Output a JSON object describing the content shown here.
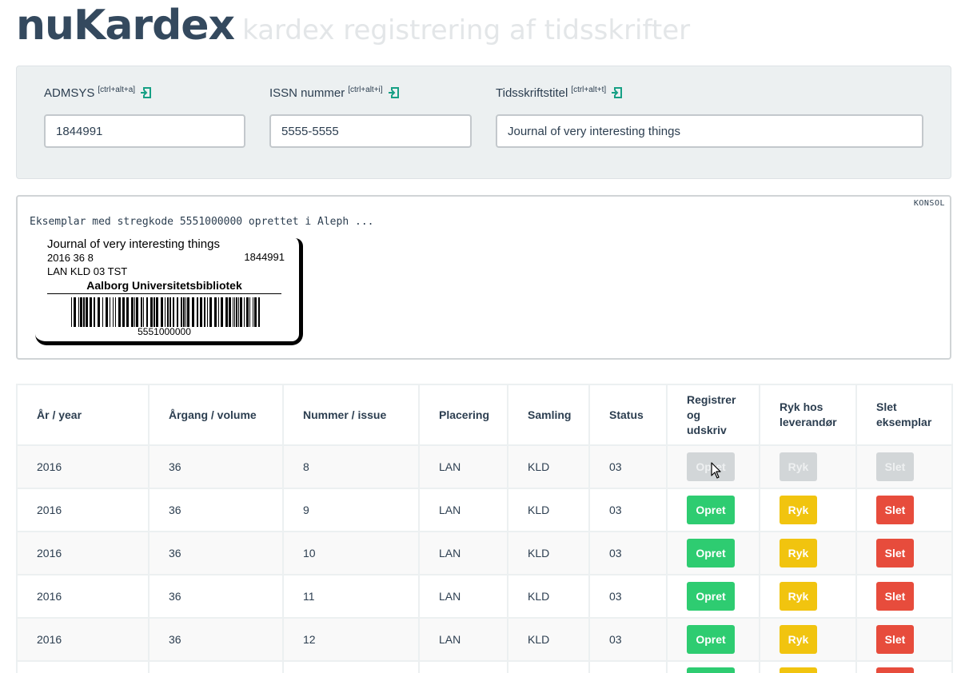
{
  "header": {
    "brand": "nuKardex",
    "tagline": "kardex registrering af tidsskrifter"
  },
  "form": {
    "admsys": {
      "label": "ADMSYS",
      "shortcut": "[ctrl+alt+a]",
      "value": "1844991"
    },
    "issn": {
      "label": "ISSN nummer",
      "shortcut": "[ctrl+alt+i]",
      "value": "5555-5555"
    },
    "title": {
      "label": "Tidsskriftstitel",
      "shortcut": "[ctrl+alt+t]",
      "value": "Journal of very interesting things"
    }
  },
  "console": {
    "tag": "KONSOL",
    "message": "Eksemplar med stregkode 5551000000 oprettet i Aleph ...",
    "label": {
      "title": "Journal of very interesting things",
      "issue": "2016 36 8",
      "admsys": "1844991",
      "location": "LAN KLD 03 TST",
      "library": "Aalborg Universitetsbibliotek",
      "barcode": "5551000000"
    }
  },
  "table": {
    "headers": {
      "year": "År / year",
      "volume": "Årgang / volume",
      "issue": "Nummer / issue",
      "placement": "Placering",
      "collection": "Samling",
      "status": "Status",
      "register": "Registrer og udskriv",
      "remind": "Ryk hos leverandør",
      "delete": "Slet eksemplar"
    },
    "buttons": {
      "create": "Opret",
      "remind": "Ryk",
      "delete": "Slet"
    },
    "rows": [
      {
        "year": "2016",
        "volume": "36",
        "issue": "8",
        "placement": "LAN",
        "collection": "KLD",
        "status": "03",
        "disabled": true
      },
      {
        "year": "2016",
        "volume": "36",
        "issue": "9",
        "placement": "LAN",
        "collection": "KLD",
        "status": "03",
        "disabled": false
      },
      {
        "year": "2016",
        "volume": "36",
        "issue": "10",
        "placement": "LAN",
        "collection": "KLD",
        "status": "03",
        "disabled": false
      },
      {
        "year": "2016",
        "volume": "36",
        "issue": "11",
        "placement": "LAN",
        "collection": "KLD",
        "status": "03",
        "disabled": false
      },
      {
        "year": "2016",
        "volume": "36",
        "issue": "12",
        "placement": "LAN",
        "collection": "KLD",
        "status": "03",
        "disabled": false
      }
    ]
  },
  "colors": {
    "create": "#2ecc71",
    "remind": "#f1c40f",
    "delete": "#e74c3c",
    "disabled": "#d2d6d8",
    "brand": "#34495e",
    "enter_icon": "#16a085"
  },
  "icons": {
    "field_action": "sign-in-icon",
    "pointer": "mouse-cursor-icon"
  }
}
